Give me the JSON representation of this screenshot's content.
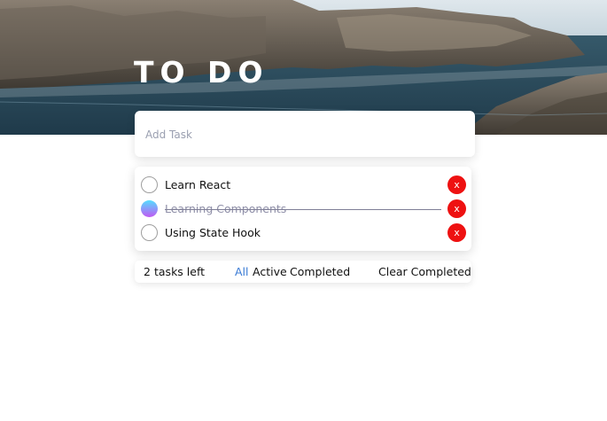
{
  "app": {
    "title": "TO DO"
  },
  "add_task": {
    "placeholder": "Add Task",
    "value": ""
  },
  "tasks": [
    {
      "label": "Learn React",
      "completed": false,
      "delete_label": "x"
    },
    {
      "label": "Learning Components",
      "completed": true,
      "delete_label": "x"
    },
    {
      "label": "Using State Hook",
      "completed": false,
      "delete_label": "x"
    }
  ],
  "footer": {
    "count": "2",
    "count_suffix": "tasks left",
    "filters": [
      "All",
      "Active",
      "Completed"
    ],
    "active_filter": "All",
    "clear_label": "Clear Completed"
  },
  "colors": {
    "accent": "#3a7bd5",
    "delete": "#ee1111",
    "check_gradient_start": "#55ddff",
    "check_gradient_end": "#c058f3"
  }
}
